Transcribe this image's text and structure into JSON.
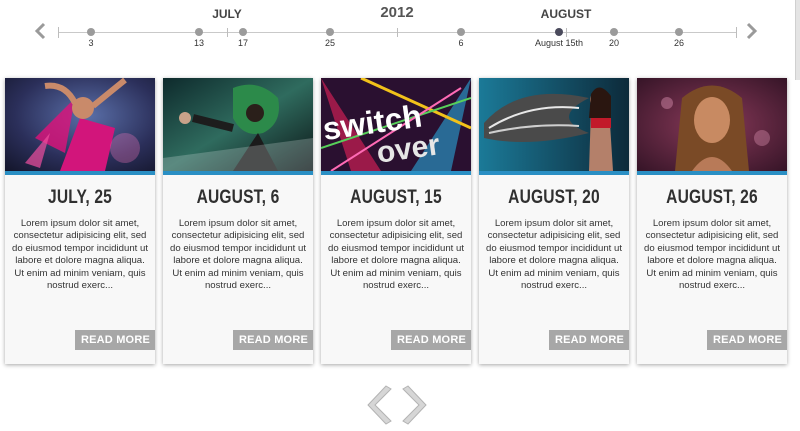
{
  "timeline": {
    "year": "2012",
    "months": [
      {
        "name": "JULY"
      },
      {
        "name": "AUGUST"
      }
    ],
    "points": [
      {
        "label": "3"
      },
      {
        "label": "13"
      },
      {
        "label": "17"
      },
      {
        "label": "25"
      },
      {
        "label": "6"
      },
      {
        "label": "August 15th",
        "active": true
      },
      {
        "label": "20"
      },
      {
        "label": "26"
      }
    ],
    "prev_icon": "chevron-left-icon",
    "next_icon": "chevron-right-icon"
  },
  "cards": [
    {
      "date": "JULY, 25",
      "text": "Lorem ipsum dolor sit amet, consectetur adipisicing elit, sed do eiusmod tempor incididunt ut labore et dolore magna aliqua. Ut enim ad minim veniam, quis nostrud exerc...",
      "button": "READ MORE"
    },
    {
      "date": "AUGUST, 6",
      "text": "Lorem ipsum dolor sit amet, consectetur adipisicing elit, sed do eiusmod tempor incididunt ut labore et dolore magna aliqua. Ut enim ad minim veniam, quis nostrud exerc...",
      "button": "READ MORE"
    },
    {
      "date": "AUGUST, 15",
      "text": "Lorem ipsum dolor sit amet, consectetur adipisicing elit, sed do eiusmod tempor incididunt ut labore et dolore magna aliqua. Ut enim ad minim veniam, quis nostrud exerc...",
      "button": "READ MORE",
      "image_text": [
        "switch",
        "over"
      ]
    },
    {
      "date": "AUGUST, 20",
      "text": "Lorem ipsum dolor sit amet, consectetur adipisicing elit, sed do eiusmod tempor incididunt ut labore et dolore magna aliqua. Ut enim ad minim veniam, quis nostrud exerc...",
      "button": "READ MORE"
    },
    {
      "date": "AUGUST, 26",
      "text": "Lorem ipsum dolor sit amet, consectetur adipisicing elit, sed do eiusmod tempor incididunt ut labore et dolore magna aliqua. Ut enim ad minim veniam, quis nostrud exerc...",
      "button": "READ MORE"
    }
  ],
  "pager": {
    "prev_icon": "chevron-left-icon",
    "next_icon": "chevron-right-icon"
  },
  "colors": {
    "accent": "#2a8fc4",
    "button_bg": "#a7a7a7",
    "dot": "#9b9b9b",
    "dot_active": "#4a4a5c"
  }
}
